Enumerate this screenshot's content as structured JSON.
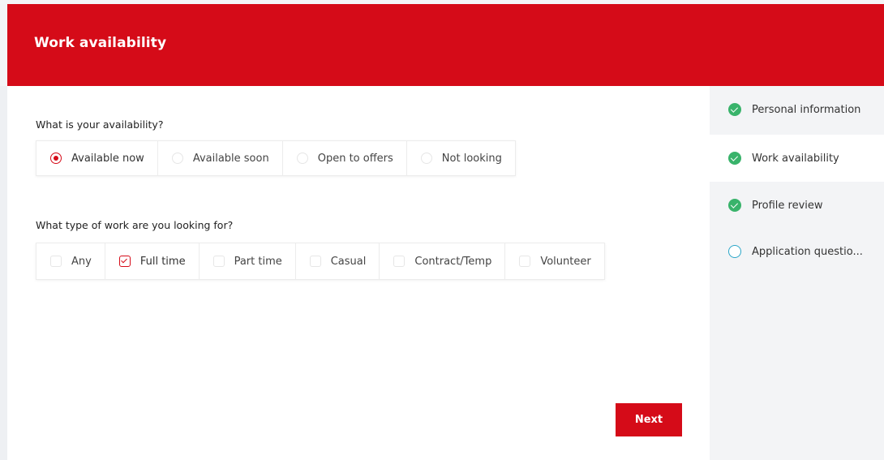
{
  "header": {
    "title": "Work availability"
  },
  "availability": {
    "question": "What is your availability?",
    "options": [
      {
        "label": "Available now",
        "selected": true
      },
      {
        "label": "Available soon",
        "selected": false
      },
      {
        "label": "Open to offers",
        "selected": false
      },
      {
        "label": "Not looking",
        "selected": false
      }
    ]
  },
  "work_type": {
    "question": "What type of work are you looking for?",
    "options": [
      {
        "label": "Any",
        "checked": false
      },
      {
        "label": "Full time",
        "checked": true
      },
      {
        "label": "Part time",
        "checked": false
      },
      {
        "label": "Casual",
        "checked": false
      },
      {
        "label": "Contract/Temp",
        "checked": false
      },
      {
        "label": "Volunteer",
        "checked": false
      }
    ]
  },
  "actions": {
    "next_label": "Next"
  },
  "steps": [
    {
      "label": "Personal information",
      "status": "complete",
      "icon": "check-circle-icon"
    },
    {
      "label": "Work availability",
      "status": "complete",
      "icon": "check-circle-icon",
      "current": true
    },
    {
      "label": "Profile review",
      "status": "complete",
      "icon": "check-circle-icon"
    },
    {
      "label": "Application questio...",
      "status": "incomplete",
      "icon": "empty-circle-icon"
    }
  ],
  "colors": {
    "brand": "#d50b18",
    "success": "#39b36b",
    "pending": "#2ba6c8"
  }
}
